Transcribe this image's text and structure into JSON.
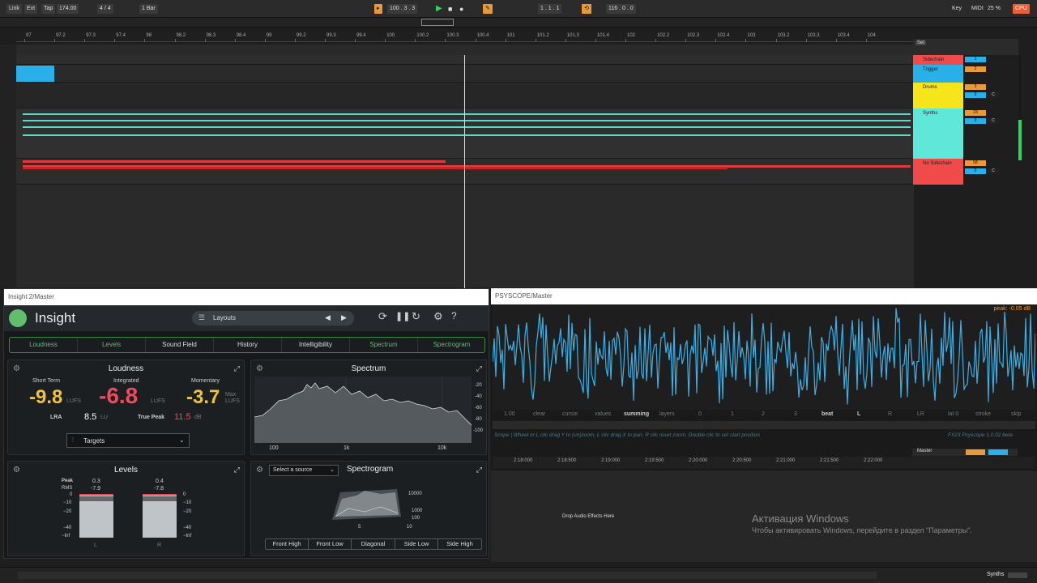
{
  "top": {
    "link": "Link",
    "ext": "Ext",
    "tap": "Tap",
    "bpm": "174.00",
    "sig": "4 / 4",
    "bar": "1 Bar",
    "pos": "100 .  3 .  3",
    "loop_start": "1 .  1 .  1",
    "loop_len": "116 .  0 .  0",
    "key": "Key",
    "midi": "MIDI",
    "cpu": "25 %"
  },
  "ruler": [
    "97",
    "97.2",
    "97.3",
    "97.4",
    "98",
    "98.2",
    "98.3",
    "98.4",
    "99",
    "99.2",
    "99.3",
    "99.4",
    "100",
    "100.2",
    "100.3",
    "100.4",
    "101",
    "101.2",
    "101.3",
    "101.4",
    "102",
    "102.2",
    "102.3",
    "102.4",
    "103",
    "103.2",
    "103.3",
    "103.4",
    "104"
  ],
  "set_label": "Set",
  "tracks": [
    {
      "name": "Sidechain",
      "color": "#f04a4a",
      "num": "1"
    },
    {
      "name": "Trigger",
      "color": "#2ab0e8",
      "num": "2"
    },
    {
      "name": "Drums",
      "color": "#f5e51a",
      "num": "3",
      "vol": "0",
      "pan": "C"
    },
    {
      "name": "Synths",
      "color": "#5fe8d9",
      "num": "23",
      "vol": "0",
      "pan": "C"
    },
    {
      "name": "No Sidechain",
      "color": "#f04a4a",
      "num": "58",
      "vol": "0",
      "pan": "C"
    }
  ],
  "insight": {
    "window_title": "Insight 2/Master",
    "app": "Insight",
    "layouts": "Layouts",
    "tabs": [
      "Loudness",
      "Levels",
      "Sound Field",
      "History",
      "Intelligibility",
      "Spectrum",
      "Spectrogram"
    ],
    "loudness": {
      "title": "Loudness",
      "short_term_label": "Short Term",
      "short_term": "-9.8",
      "integrated_label": "Integrated",
      "integrated": "-6.8",
      "momentary_label": "Momentary",
      "momentary": "-3.7",
      "lufs": "LUFS",
      "max": "Max",
      "lra_label": "LRA",
      "lra": "8.5",
      "lu": "LU",
      "tp_label": "True Peak",
      "tp": "11.5",
      "db": "dB",
      "targets": "Targets"
    },
    "spectrum": {
      "title": "Spectrum",
      "y": [
        "-20",
        "-40",
        "-60",
        "-80",
        "-100"
      ],
      "x": [
        "100",
        "1k",
        "10k"
      ]
    },
    "levels": {
      "title": "Levels",
      "peak_label": "Peak",
      "rms_label": "RMS",
      "l_peak": "0.3",
      "l_rms": "-7.9",
      "r_peak": "0.4",
      "r_rms": "-7.8",
      "scale": [
        "0",
        "−10",
        "−20",
        "−40",
        "−Inf"
      ],
      "l": "L",
      "r": "R"
    },
    "spectrogram": {
      "title": "Spectrogram",
      "source": "Select a source",
      "freq": [
        "10000",
        "1000",
        "100"
      ],
      "time": [
        "5",
        "10"
      ],
      "views": [
        "Front High",
        "Front Low",
        "Diagonal",
        "Side Low",
        "Side High"
      ]
    }
  },
  "psyscope": {
    "window_title": "PSYSCOPE/Master",
    "peak": "peak: -0.05 dB",
    "controls": [
      "1.00",
      "clear",
      "cursor",
      "values",
      "summing",
      "layers",
      "0",
      "1",
      "2",
      "3",
      "beat",
      "L",
      "R",
      "LR",
      "lat 0",
      "stroke",
      "skip"
    ],
    "help": "Scope | Wheel or L clic drag Y to (un)zoom, L clic drag X to pan, R clic reset zoom, Double clic to set start position",
    "version": "FX23 Psyscope 1.0.02 beta",
    "times": [
      "2:18:000",
      "2:18:500",
      "2:19:000",
      "2:19:500",
      "2:20:000",
      "2:20:500",
      "2:21:000",
      "2:21:500",
      "2:22:000"
    ],
    "master": "Master"
  },
  "drop_label": "Drop Audio Effects Here",
  "activation": {
    "title": "Активация Windows",
    "body": "Чтобы активировать Windows, перейдите в раздел \"Параметры\"."
  },
  "status": {
    "track": "Synths"
  }
}
